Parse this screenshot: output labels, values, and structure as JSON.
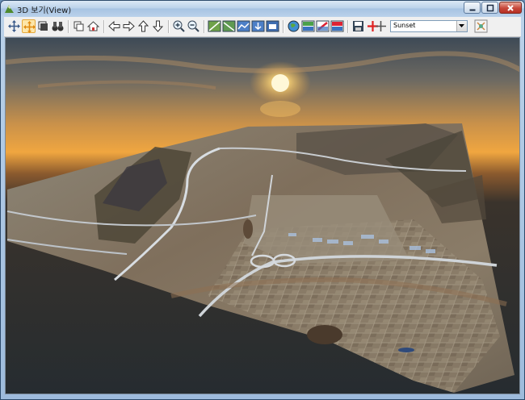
{
  "window": {
    "title": "3D 보기(View)",
    "icon": "3d-app-icon"
  },
  "toolbar": {
    "buttons": [
      {
        "name": "move-arrows-icon"
      },
      {
        "name": "pan-hand-icon",
        "active": true
      },
      {
        "name": "layer-stack-icon"
      },
      {
        "name": "binoculars-icon"
      },
      {
        "name": "copy-view-icon"
      },
      {
        "name": "home-icon"
      },
      {
        "name": "arrow-left-icon"
      },
      {
        "name": "arrow-right-icon"
      },
      {
        "name": "arrow-up-icon"
      },
      {
        "name": "arrow-down-icon"
      },
      {
        "name": "zoom-in-icon"
      },
      {
        "name": "zoom-out-icon"
      },
      {
        "name": "terrain-tool-1-icon"
      },
      {
        "name": "terrain-tool-2-icon"
      },
      {
        "name": "terrain-tool-3-icon"
      },
      {
        "name": "terrain-tool-4-icon"
      },
      {
        "name": "terrain-tool-5-icon"
      },
      {
        "name": "globe-icon"
      },
      {
        "name": "image-layer-1-icon"
      },
      {
        "name": "image-layer-2-icon"
      },
      {
        "name": "image-layer-3-icon"
      },
      {
        "name": "save-icon"
      },
      {
        "name": "red-plus-icon"
      },
      {
        "name": "plus-icon"
      },
      {
        "name": "settings-icon"
      }
    ],
    "sky_select": {
      "value": "Sunset"
    }
  },
  "colors": {
    "sky_top": "#3e4a56",
    "sun": "#fff6c8",
    "horizon_glow": "#f0a640",
    "ground": "#262c30",
    "terrain": "#8a7c68"
  }
}
